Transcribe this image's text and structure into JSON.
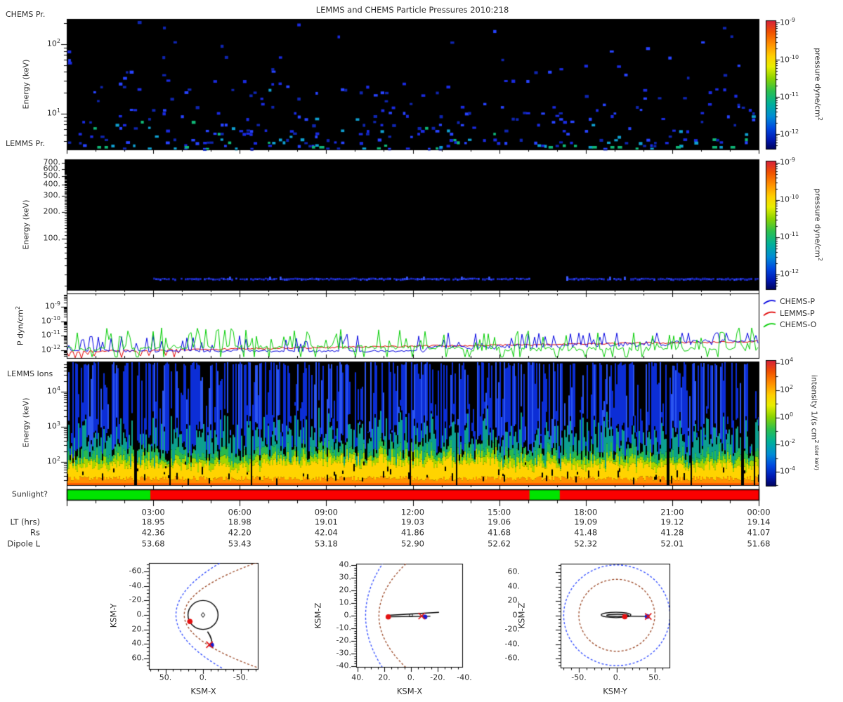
{
  "title": "LEMMS and CHEMS Particle Pressures  2010:218",
  "chart_data": [
    {
      "id": "chems-pressure-panel",
      "type": "heatmap",
      "corner_label": "CHEMS Pr.",
      "ylabel": "Energy (keV)",
      "y_ticks": [
        "10^2",
        "10^1"
      ],
      "y_scale": "log",
      "y_range_kev": [
        3,
        230
      ],
      "x_range_hours": [
        0,
        24
      ],
      "background": "#000000",
      "dot_colors": [
        "#1a2be0",
        "#2743ff",
        "#0f25b0",
        "#0f9fd0",
        "#10b877"
      ],
      "pattern": "sparse scattered pressure pixels, mostly blue, density increases toward low energy, teal-green dashes along bottom edge",
      "colorbar": {
        "label": "pressure dyne/cm^2",
        "ticks": [
          "10^-9",
          "10^-10",
          "10^-11",
          "10^-12"
        ]
      }
    },
    {
      "id": "lemms-pressure-panel",
      "type": "heatmap",
      "corner_label": "LEMMS Pr.",
      "ylabel": "Energy (keV)",
      "y_ticks": [
        "700.",
        "600.",
        "500.",
        "400.",
        "300.",
        "200.",
        "100."
      ],
      "y_scale": "log",
      "y_range_kev": [
        27,
        760
      ],
      "x_range_hours": [
        0,
        24
      ],
      "background": "#000000",
      "blue_band": {
        "energy_kev": 36,
        "color": "#2433e0",
        "segments_frac": [
          [
            0.125,
            0.67
          ],
          [
            0.723,
            1.0
          ]
        ]
      },
      "colorbar": {
        "label": "pressure dyne/cm^2",
        "ticks": [
          "10^-9",
          "10^-10",
          "10^-11",
          "10^-12"
        ]
      }
    },
    {
      "id": "particle-pressure-lines",
      "type": "line",
      "ylabel": "P dyn/cm^2",
      "y_ticks": [
        "10^-9",
        "10^-10",
        "10^-11",
        "10^-12"
      ],
      "y_scale": "log",
      "x_range_hours": [
        0,
        24
      ],
      "series": [
        {
          "name": "CHEMS-P",
          "color": "#0000e0",
          "baseline_log10": -12.0,
          "spikes_to_log10": -11.0,
          "trend": "noisy spikes, rises to ~1e-11 in second half"
        },
        {
          "name": "LEMMS-P",
          "color": "#e00000",
          "baseline_log10": -12.1,
          "spikes_to_log10": -11.4,
          "trend": "smooth gradual rise to ~4e-12"
        },
        {
          "name": "CHEMS-O",
          "color": "#00cc00",
          "baseline_log10": -11.9,
          "spikes_to_log10": -10.5,
          "trend": "frequent tall spikes over whole interval"
        }
      ],
      "legend": [
        "CHEMS-P",
        "LEMMS-P",
        "CHEMS-O"
      ],
      "legend_colors": [
        "#0000e0",
        "#e00000",
        "#00cc00"
      ]
    },
    {
      "id": "lemms-ions-panel",
      "type": "heatmap",
      "corner_label": "LEMMS Ions",
      "ylabel": "Energy (keV)",
      "y_ticks": [
        "10^4",
        "10^3",
        "10^2"
      ],
      "y_scale": "log",
      "x_range_hours": [
        0,
        24
      ],
      "background": "#000000",
      "pattern": "intense orange-yellow band at lowest energies, green-teal spikes at mid energies, blue spikes reaching high energies, random black dropout columns",
      "band_colors": [
        "#ff5f00",
        "#ff9100",
        "#ffd400",
        "#a7d400",
        "#29b94e",
        "#0d9f8f",
        "#0c2ed6"
      ],
      "colorbar": {
        "label": "intensity 1/(s cm^2 ster keV)",
        "ticks": [
          "10^4",
          "10^2",
          "10^0",
          "10^-2",
          "10^-4"
        ]
      }
    },
    {
      "id": "sunlight-bar",
      "type": "bar",
      "label": "Sunlight?",
      "yes_color": "#00e400",
      "no_color": "#fb0000",
      "yes_intervals_hours": [
        [
          0,
          2.9
        ],
        [
          16.05,
          17.1
        ]
      ],
      "x_range_hours": [
        0,
        24
      ]
    },
    {
      "id": "time-axis",
      "type": "table",
      "time_ticks": [
        "03:00",
        "06:00",
        "09:00",
        "12:00",
        "15:00",
        "18:00",
        "21:00",
        "00:00"
      ],
      "rows": [
        {
          "label": "LT (hrs)",
          "values": [
            "18.95",
            "18.98",
            "19.01",
            "19.03",
            "19.06",
            "19.09",
            "19.12",
            "19.14"
          ]
        },
        {
          "label": "Rs",
          "values": [
            "42.36",
            "42.20",
            "42.04",
            "41.86",
            "41.68",
            "41.48",
            "41.28",
            "41.07"
          ]
        },
        {
          "label": "Dipole L",
          "values": [
            "53.68",
            "53.43",
            "53.18",
            "52.90",
            "52.62",
            "52.32",
            "52.01",
            "51.68"
          ]
        }
      ]
    },
    {
      "id": "orbit-xy",
      "type": "scatter",
      "xlabel": "KSM-X",
      "ylabel": "KSM-Y",
      "x_ticks": [
        "50.",
        "0.",
        "-50."
      ],
      "y_ticks": [
        "-60.",
        "-40.",
        "-20.",
        "0.",
        "20.",
        "40.",
        "60."
      ],
      "x_reversed": true,
      "features": {
        "bow_shock": {
          "color": "#2a46ff",
          "style": "dashed",
          "nose_x": 36,
          "flare": 0.0114
        },
        "magnetopause": {
          "color": "#994422",
          "style": "dashed",
          "nose_x": 25,
          "flare": 0.0185
        },
        "planet_circle_radius": 20,
        "center_marker": "diamond",
        "red_dot": [
          17.5,
          9
        ],
        "trajectory": [
          [
            -6,
            23
          ],
          [
            -13,
            33
          ],
          [
            -12,
            44
          ]
        ],
        "cross_marker": [
          -8.5,
          41
        ],
        "blue_dot": [
          -11.5,
          41.5
        ]
      }
    },
    {
      "id": "orbit-xz",
      "type": "scatter",
      "xlabel": "KSM-X",
      "ylabel": "KSM-Z",
      "x_ticks": [
        "40.",
        "20.",
        "0.",
        "-20.",
        "-40."
      ],
      "y_ticks": [
        "40.",
        "30.",
        "20.",
        "10.",
        "0.",
        "-10.",
        "-20.",
        "-30.",
        "-40."
      ],
      "x_reversed": true,
      "features": {
        "bow_shock": {
          "color": "#2a46ff",
          "style": "dashed",
          "nose_x": 34,
          "flare": 0.0075
        },
        "magnetopause": {
          "color": "#994422",
          "style": "dashed",
          "nose_x": 24,
          "flare": 0.012
        },
        "trajectory_lines": [
          [
            [
              16.5,
              0.3
            ],
            [
              -21,
              2.6
            ]
          ],
          [
            [
              16.5,
              -0.9
            ],
            [
              -14.5,
              -0.5
            ]
          ]
        ],
        "origin_circle": [
          0,
          0.3
        ],
        "red_dot": [
          17,
          -1
        ],
        "cross_marker": [
          -8,
          -0.3
        ],
        "blue_dot": [
          -10.5,
          -1
        ]
      }
    },
    {
      "id": "orbit-yz",
      "type": "scatter",
      "xlabel": "KSM-Y",
      "ylabel": "KSM-Z",
      "x_ticks": [
        "-50.",
        "0.",
        "50."
      ],
      "y_ticks": [
        "60.",
        "40.",
        "20.",
        "0.",
        "-20.",
        "-40.",
        "-60."
      ],
      "features": {
        "bow_shock_circle": {
          "color": "#2a46ff",
          "style": "dashed",
          "radius": 70
        },
        "magnetopause_circle": {
          "color": "#994422",
          "style": "dashed",
          "radius": 50
        },
        "orbit_ellipse": {
          "cx": -1,
          "cy": 0.5,
          "rx": 19.5,
          "ry": 2.6
        },
        "tail_line": [
          [
            13,
            -1.4
          ],
          [
            40,
            -1.6
          ]
        ],
        "red_dot": [
          10.5,
          -2
        ],
        "cross_marker": [
          41.5,
          -1.6
        ],
        "blue_dot": [
          40,
          -1.6
        ]
      }
    }
  ]
}
